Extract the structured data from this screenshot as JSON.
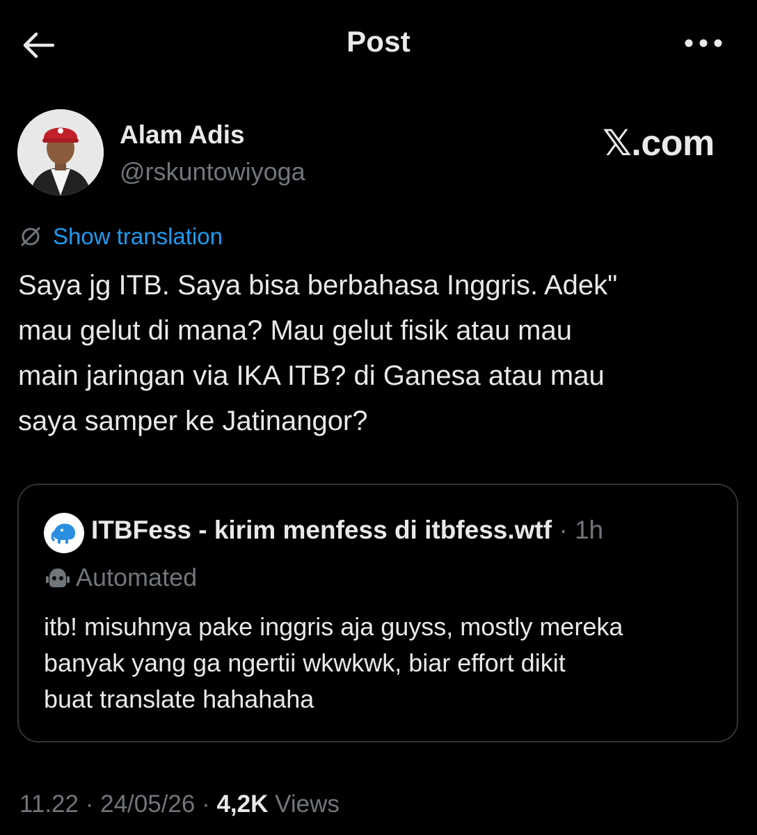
{
  "topbar": {
    "title": "Post",
    "back_icon": "arrow-left-icon",
    "more_icon": "more-horizontal-icon"
  },
  "author": {
    "name": "Alam Adis",
    "handle": "@rskuntowiyoga"
  },
  "watermark": "𝕏.com",
  "translation": {
    "icon": "globe-icon",
    "label": "Show translation"
  },
  "post": {
    "text": "Saya jg ITB. Saya bisa berbahasa Inggris. Adek\"\nmau gelut di mana? Mau gelut fisik atau mau\nmain jaringan via IKA ITB? di Ganesa atau mau\nsaya samper ke Jatinangor?"
  },
  "quote": {
    "author_name": "ITBFess - kirim menfess di itbfess.wtf",
    "separator": " · ",
    "time": "1h",
    "automated_icon": "bot-icon",
    "automated_label": "Automated",
    "text": "itb! misuhnya pake inggris aja guyss, mostly mereka\nbanyak yang ga ngertii wkwkwk, biar effort dikit\nbuat translate hahahaha"
  },
  "meta": {
    "time": "11.22",
    "sep1": " · ",
    "date": "24/05/26",
    "sep2": " · ",
    "views_count": "4,2K",
    "views_label": " Views"
  },
  "colors": {
    "background": "#000000",
    "text_primary": "#e7e9ea",
    "text_secondary": "#71767b",
    "link": "#1d9bf0",
    "border": "#2f3336"
  }
}
